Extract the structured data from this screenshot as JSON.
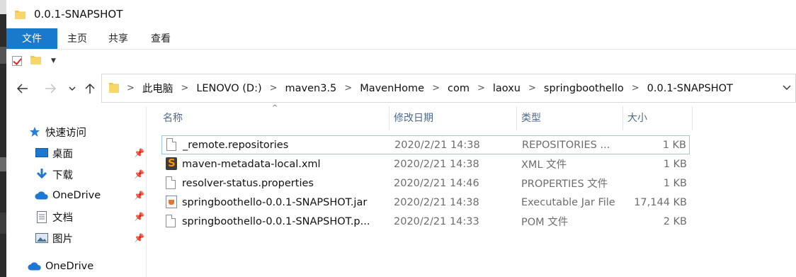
{
  "window": {
    "title": "0.0.1-SNAPSHOT"
  },
  "ribbon": {
    "tabs": [
      {
        "label": "文件"
      },
      {
        "label": "主页"
      },
      {
        "label": "共享"
      },
      {
        "label": "查看"
      }
    ]
  },
  "address_bar": {
    "breadcrumbs": [
      "此电脑",
      "LENOVO (D:)",
      "maven3.5",
      "MavenHome",
      "com",
      "laoxu",
      "springboothello",
      "0.0.1-SNAPSHOT"
    ]
  },
  "nav_pane": {
    "items": [
      {
        "label": "快速访问",
        "icon": "star-icon",
        "pinned": false
      },
      {
        "label": "桌面",
        "icon": "desktop-icon",
        "pinned": true
      },
      {
        "label": "下载",
        "icon": "download-icon",
        "pinned": true
      },
      {
        "label": "OneDrive",
        "icon": "cloud-icon",
        "pinned": true
      },
      {
        "label": "文档",
        "icon": "documents-icon",
        "pinned": true
      },
      {
        "label": "图片",
        "icon": "pictures-icon",
        "pinned": true
      },
      {
        "label": "OneDrive",
        "icon": "cloud-icon",
        "pinned": false
      }
    ]
  },
  "file_list": {
    "columns": {
      "name": "名称",
      "date": "修改日期",
      "type": "类型",
      "size": "大小"
    },
    "rows": [
      {
        "name": "_remote.repositories",
        "date": "2020/2/21 14:38",
        "type": "REPOSITORIES ...",
        "size": "1 KB",
        "icon": "file-icon",
        "selected": true
      },
      {
        "name": "maven-metadata-local.xml",
        "date": "2020/2/21 14:38",
        "type": "XML 文件",
        "size": "1 KB",
        "icon": "sublime-text-icon",
        "selected": false
      },
      {
        "name": "resolver-status.properties",
        "date": "2020/2/21 14:46",
        "type": "PROPERTIES 文件",
        "size": "1 KB",
        "icon": "file-icon",
        "selected": false
      },
      {
        "name": "springboothello-0.0.1-SNAPSHOT.jar",
        "date": "2020/2/21 14:38",
        "type": "Executable Jar File",
        "size": "17,144 KB",
        "icon": "java-jar-icon",
        "selected": false
      },
      {
        "name": "springboothello-0.0.1-SNAPSHOT.p...",
        "date": "2020/2/21 14:33",
        "type": "POM 文件",
        "size": "2 KB",
        "icon": "file-icon",
        "selected": false
      }
    ]
  },
  "colors": {
    "file_tab": "#1979ca",
    "selection_border": "#98c6f0",
    "folder": "#f3c546"
  }
}
